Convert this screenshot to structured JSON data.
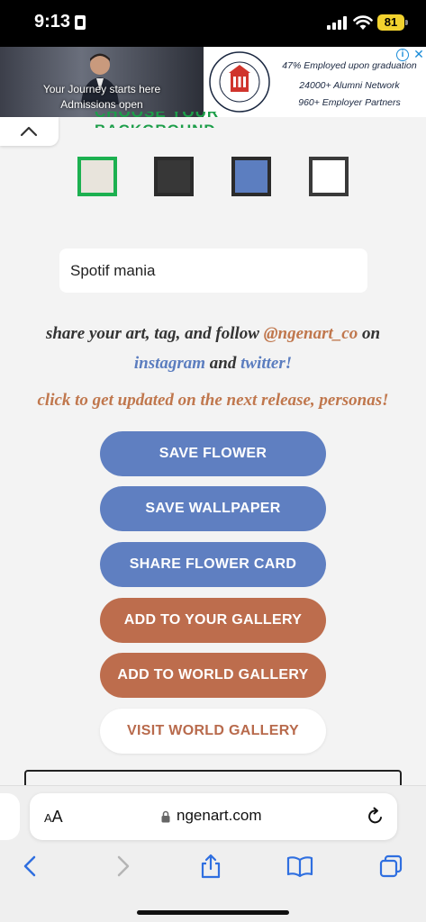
{
  "status": {
    "time": "9:13",
    "battery": "81"
  },
  "ad": {
    "caption_line1": "Your Journey starts here",
    "caption_line2": "Admissions open",
    "stat1": "47% Employed upon graduation",
    "stat2": "24000+ Alumni Network",
    "stat3": "960+ Employer Partners",
    "info_symbol": "i",
    "close_symbol": "✕"
  },
  "page": {
    "background_heading": "CHOOSE YOUR BACKGROUND",
    "swatches": [
      {
        "name": "beige",
        "color": "#e8e4dc",
        "selected": true
      },
      {
        "name": "dark-gray",
        "color": "#373737",
        "selected": false
      },
      {
        "name": "blue",
        "color": "#5c7ec0",
        "selected": false
      },
      {
        "name": "white",
        "color": "#ffffff",
        "selected": false
      }
    ],
    "name_input_value": "Spotif mania",
    "share_prefix": "share your art, tag, and follow ",
    "share_handle": "@ngenart_co",
    "share_on": " on",
    "instagram": "instagram",
    "and": " and ",
    "twitter": "twitter!",
    "update_text": "click to get updated on the next release, personas!",
    "buttons": {
      "save_flower": "SAVE FLOWER",
      "save_wallpaper": "SAVE WALLPAPER",
      "share_flower_card": "SHARE FLOWER CARD",
      "add_to_your_gallery": "ADD TO YOUR GALLERY",
      "add_to_world_gallery": "ADD TO WORLD GALLERY",
      "visit_world_gallery": "VISIT WORLD GALLERY"
    }
  },
  "browser": {
    "aa_label_small": "A",
    "aa_label_large": "A",
    "url": "ngenart.com"
  },
  "colors": {
    "accent_green": "#1c9e49",
    "button_blue": "#5f7fc1",
    "button_brown": "#bd6d4d",
    "link_blue": "#5b7dbf",
    "handle_brown": "#c0774d"
  }
}
